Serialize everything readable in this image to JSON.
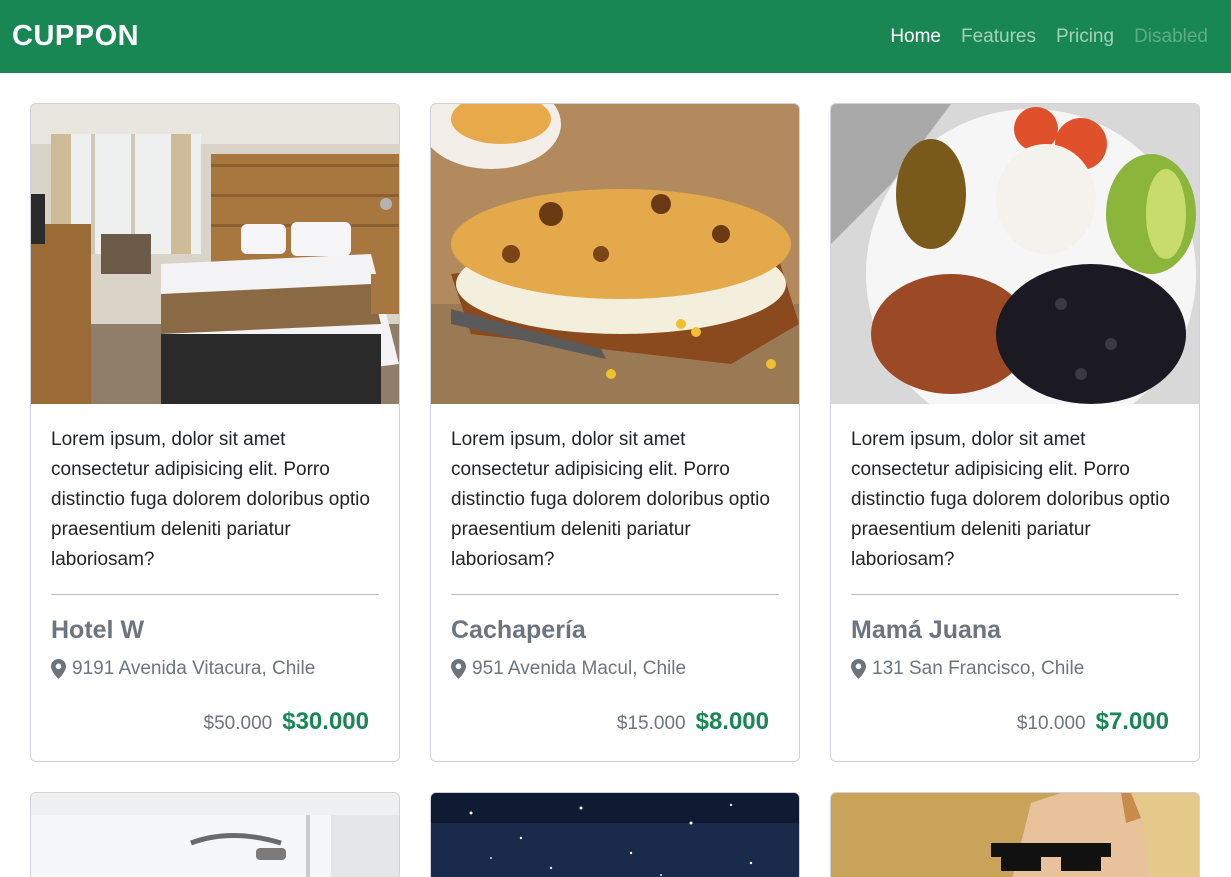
{
  "navbar": {
    "brand": "CUPPON",
    "links": [
      "Home",
      "Features",
      "Pricing",
      "Disabled"
    ]
  },
  "cards": [
    {
      "image": "hotel-room-photo",
      "text": "Lorem ipsum, dolor sit amet consectetur adipisicing elit. Porro distinctio fuga dolorem doloribus optio praesentium deleniti pariatur laboriosam?",
      "title": "Hotel W",
      "address": "9191 Avenida Vitacura, Chile",
      "old_price": "$50.000",
      "new_price": "$30.000"
    },
    {
      "image": "cachapa-photo",
      "text": "Lorem ipsum, dolor sit amet consectetur adipisicing elit. Porro distinctio fuga dolorem doloribus optio praesentium deleniti pariatur laboriosam?",
      "title": "Cachapería",
      "address": "951 Avenida Macul, Chile",
      "old_price": "$15.000",
      "new_price": "$8.000"
    },
    {
      "image": "pabellon-plate-photo",
      "text": "Lorem ipsum, dolor sit amet consectetur adipisicing elit. Porro distinctio fuga dolorem doloribus optio praesentium deleniti pariatur laboriosam?",
      "title": "Mamá Juana",
      "address": "131 San Francisco, Chile",
      "old_price": "$10.000",
      "new_price": "$7.000"
    }
  ],
  "colors": {
    "brand_green": "#198754",
    "muted": "#6c757d"
  }
}
